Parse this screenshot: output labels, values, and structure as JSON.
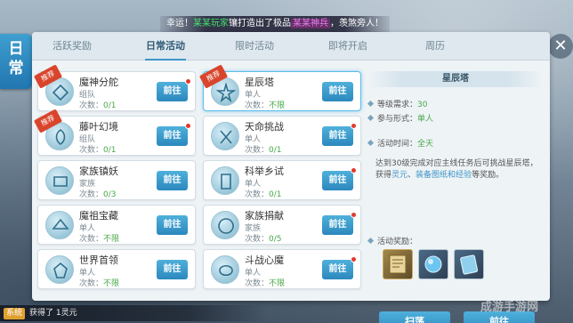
{
  "side_title": [
    "日",
    "常"
  ],
  "banner": {
    "prefix": "幸运！",
    "player": "某某玩家",
    "middle": "镶打造出了极品",
    "item": "某某神兵",
    "suffix": "，羡煞旁人！"
  },
  "close_label": "✕",
  "tabs": [
    {
      "label": "活跃奖励",
      "active": false
    },
    {
      "label": "日常活动",
      "active": true
    },
    {
      "label": "限时活动",
      "active": false
    },
    {
      "label": "即将开启",
      "active": false
    },
    {
      "label": "周历",
      "active": false
    }
  ],
  "activities": [
    {
      "title": "魔神分舵",
      "type": "组队",
      "count_label": "次数：",
      "count": "0/1",
      "unlimited": false,
      "recommend": "推荐",
      "button": "前往",
      "dot": true,
      "icon": "demon-altar-icon"
    },
    {
      "title": "星辰塔",
      "type": "单人",
      "count_label": "次数：",
      "count": "不限",
      "unlimited": true,
      "recommend": "推荐",
      "button": "前往",
      "dot": false,
      "selected": true,
      "icon": "star-tower-icon"
    },
    {
      "title": "藤叶幻境",
      "type": "组队",
      "count_label": "次数：",
      "count": "0/1",
      "unlimited": false,
      "recommend": "推荐",
      "button": "前往",
      "dot": true,
      "icon": "vine-realm-icon"
    },
    {
      "title": "天命挑战",
      "type": "单人",
      "count_label": "次数：",
      "count": "0/1",
      "unlimited": false,
      "recommend": "",
      "button": "前往",
      "dot": true,
      "icon": "destiny-challenge-icon"
    },
    {
      "title": "家族镇妖",
      "type": "家族",
      "count_label": "次数：",
      "count": "0/3",
      "unlimited": false,
      "recommend": "",
      "button": "前往",
      "dot": false,
      "icon": "clan-seal-icon"
    },
    {
      "title": "科举乡试",
      "type": "单人",
      "count_label": "次数：",
      "count": "0/1",
      "unlimited": false,
      "recommend": "",
      "button": "前往",
      "dot": true,
      "icon": "exam-scroll-icon"
    },
    {
      "title": "魔祖宝藏",
      "type": "单人",
      "count_label": "次数：",
      "count": "不限",
      "unlimited": true,
      "recommend": "",
      "button": "前往",
      "dot": false,
      "icon": "treasure-icon"
    },
    {
      "title": "家族捐献",
      "type": "家族",
      "count_label": "次数：",
      "count": "0/5",
      "unlimited": false,
      "recommend": "",
      "button": "前往",
      "dot": true,
      "icon": "clan-donate-icon"
    },
    {
      "title": "世界首领",
      "type": "单人",
      "count_label": "次数：",
      "count": "不限",
      "unlimited": true,
      "recommend": "",
      "button": "前往",
      "dot": false,
      "icon": "world-boss-icon"
    },
    {
      "title": "斗战心魔",
      "type": "单人",
      "count_label": "次数：",
      "count": "不限",
      "unlimited": true,
      "recommend": "",
      "button": "前往",
      "dot": true,
      "icon": "heart-demon-icon"
    }
  ],
  "detail": {
    "title": "星辰塔",
    "level_label": "等级需求：",
    "level": "30",
    "mode_label": "参与形式：",
    "mode": "单人",
    "time_label": "活动时间：",
    "time": "全天",
    "desc_a": "达到30级完成对应主线任务后可挑战星辰塔，获得",
    "desc_b": "灵元",
    "desc_c": "、",
    "desc_d": "装备图纸和经验",
    "desc_e": "等奖励。",
    "reward_label": "活动奖励：",
    "rewards": [
      "blueprint-icon",
      "spirit-orb-icon",
      "exp-book-icon"
    ],
    "sweep_button": "扫荡",
    "go_button": "前往"
  },
  "bottom": {
    "tag": "系统",
    "text": "获得了 1灵元"
  },
  "watermark": "成游手游网"
}
